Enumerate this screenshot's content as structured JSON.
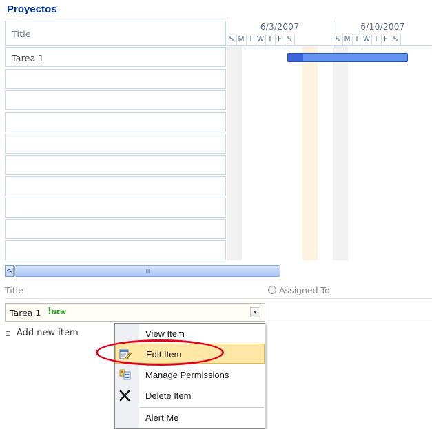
{
  "page": {
    "title": "Proyectos"
  },
  "gantt": {
    "title_column_header": "Title",
    "rows": [
      "Tarea 1",
      "",
      "",
      "",
      "",
      "",
      "",
      "",
      "",
      ""
    ],
    "weeks": [
      "6/3/2007",
      "6/10/2007"
    ],
    "day_letters": [
      "S",
      "M",
      "T",
      "W",
      "T",
      "F",
      "S",
      "S",
      "M",
      "T",
      "W",
      "T",
      "F",
      "S"
    ],
    "task_bar_color": "#6394f0",
    "today_highlight_color": "#fdf3de"
  },
  "scrollbar": {
    "left_arrow": "<",
    "grip": "IIII"
  },
  "list": {
    "columns": [
      "Title",
      "Assigned To"
    ],
    "item": {
      "title": "Tarea 1",
      "new_icon": "!",
      "new_label": "NEW",
      "dropdown": "▾"
    },
    "add_new_item": "Add new item"
  },
  "context_menu": {
    "items": [
      {
        "label": "View Item",
        "icon": "none"
      },
      {
        "label": "Edit Item",
        "icon": "edit-item-icon"
      },
      {
        "label": "Manage Permissions",
        "icon": "manage-permissions-icon"
      },
      {
        "label": "Delete Item",
        "icon": "delete-x-icon"
      },
      {
        "label": "Alert Me",
        "icon": "none"
      }
    ],
    "highlight_color": "#ffe7a6",
    "annotation_color": "#e3001b"
  }
}
